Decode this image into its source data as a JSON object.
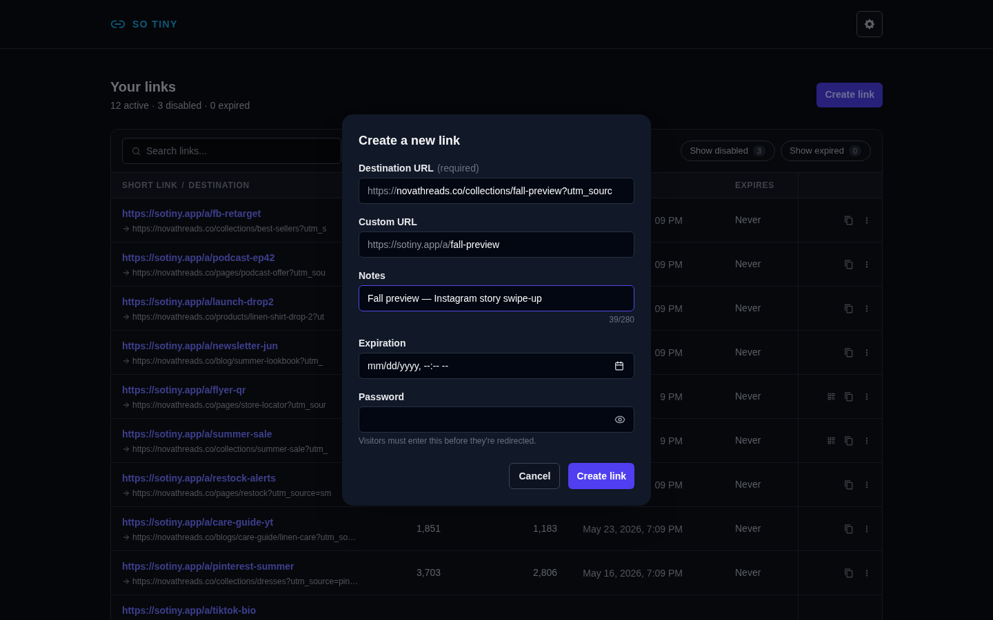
{
  "header": {
    "brand": "SO TINY"
  },
  "page": {
    "title": "Your links",
    "summary": "12 active · 3 disabled · 0 expired",
    "create_button": "Create link"
  },
  "toolbar": {
    "search": {
      "placeholder": "Search links..."
    },
    "filters": [
      {
        "label": "Show disabled",
        "count": "3"
      },
      {
        "label": "Show expired",
        "count": "0"
      }
    ]
  },
  "table": {
    "columns": {
      "link_column": [
        "SHORT LINK",
        "/",
        "DESTINATION"
      ],
      "expires_column": "EXPIRES"
    },
    "rows": [
      {
        "short_link": "https://sotiny.app/a/fb-retarget",
        "destination": "https://novathreads.co/collections/best-sellers?utm_s",
        "column_4": "09 PM",
        "expires": "Never",
        "actions": [
          {
            "kind": "copy"
          },
          {
            "kind": "more"
          }
        ]
      },
      {
        "short_link": "https://sotiny.app/a/podcast-ep42",
        "destination": "https://novathreads.co/pages/podcast-offer?utm_sou",
        "column_4": "09 PM",
        "expires": "Never",
        "actions": [
          {
            "kind": "copy"
          },
          {
            "kind": "more"
          }
        ]
      },
      {
        "short_link": "https://sotiny.app/a/launch-drop2",
        "destination": "https://novathreads.co/products/linen-shirt-drop-2?ut",
        "column_4": "09 PM",
        "expires": "Never",
        "actions": [
          {
            "kind": "copy"
          },
          {
            "kind": "more"
          }
        ]
      },
      {
        "short_link": "https://sotiny.app/a/newsletter-jun",
        "destination": "https://novathreads.co/blog/summer-lookbook?utm_",
        "column_4": "09 PM",
        "expires": "Never",
        "actions": [
          {
            "kind": "copy"
          },
          {
            "kind": "more"
          }
        ]
      },
      {
        "short_link": "https://sotiny.app/a/flyer-qr",
        "destination": "https://novathreads.co/pages/store-locator?utm_sour",
        "column_4": "9 PM",
        "expires": "Never",
        "actions": [
          {
            "kind": "qr"
          },
          {
            "kind": "copy"
          },
          {
            "kind": "more"
          }
        ]
      },
      {
        "short_link": "https://sotiny.app/a/summer-sale",
        "destination": "https://novathreads.co/collections/summer-sale?utm_",
        "column_4": "9 PM",
        "expires": "Never",
        "actions": [
          {
            "kind": "qr"
          },
          {
            "kind": "copy"
          },
          {
            "kind": "more"
          }
        ]
      },
      {
        "short_link": "https://sotiny.app/a/restock-alerts",
        "destination": "https://novathreads.co/pages/restock?utm_source=sm",
        "column_4": "09 PM",
        "expires": "Never",
        "actions": [
          {
            "kind": "copy"
          },
          {
            "kind": "more"
          }
        ]
      },
      {
        "short_link": "https://sotiny.app/a/care-guide-yt",
        "destination": "https://novathreads.co/blogs/care-guide/linen-care?utm_so…",
        "column_2": "1,851",
        "column_3": "1,183",
        "column_4": "May 23, 2026, 7:09 PM",
        "expires": "Never",
        "actions": [
          {
            "kind": "copy"
          },
          {
            "kind": "more"
          }
        ]
      },
      {
        "short_link": "https://sotiny.app/a/pinterest-summer",
        "destination": "https://novathreads.co/collections/dresses?utm_source=pin…",
        "column_2": "3,703",
        "column_3": "2,806",
        "column_4": "May 16, 2026, 7:09 PM",
        "expires": "Never",
        "actions": [
          {
            "kind": "copy"
          },
          {
            "kind": "more"
          }
        ]
      },
      {
        "short_link": "https://sotiny.app/a/tiktok-bio"
      }
    ]
  },
  "dialog": {
    "title": "Create a new link",
    "fields": [
      {
        "kind": "url",
        "label": "Destination URL",
        "note": "(required)",
        "prefix": "https://",
        "value": "novathreads.co/collections/fall-preview?utm_sourc",
        "focused": false
      },
      {
        "kind": "url",
        "label": "Custom URL",
        "prefix": "https://sotiny.app/a/",
        "value": "fall-preview",
        "focused": false
      },
      {
        "kind": "text",
        "label": "Notes",
        "value": "Fall preview — Instagram story swipe-up",
        "counter": "39/280",
        "focused": true
      },
      {
        "kind": "datetime",
        "label": "Expiration",
        "placeholder": "mm/dd/yyyy, --:-- --",
        "focused": false
      },
      {
        "kind": "password",
        "label": "Password",
        "hint": "Visitors must enter this before they're redirected.",
        "focused": false
      }
    ],
    "buttons": [
      {
        "kind": "secondary",
        "label": "Cancel"
      },
      {
        "kind": "primary",
        "label": "Create link"
      }
    ]
  }
}
